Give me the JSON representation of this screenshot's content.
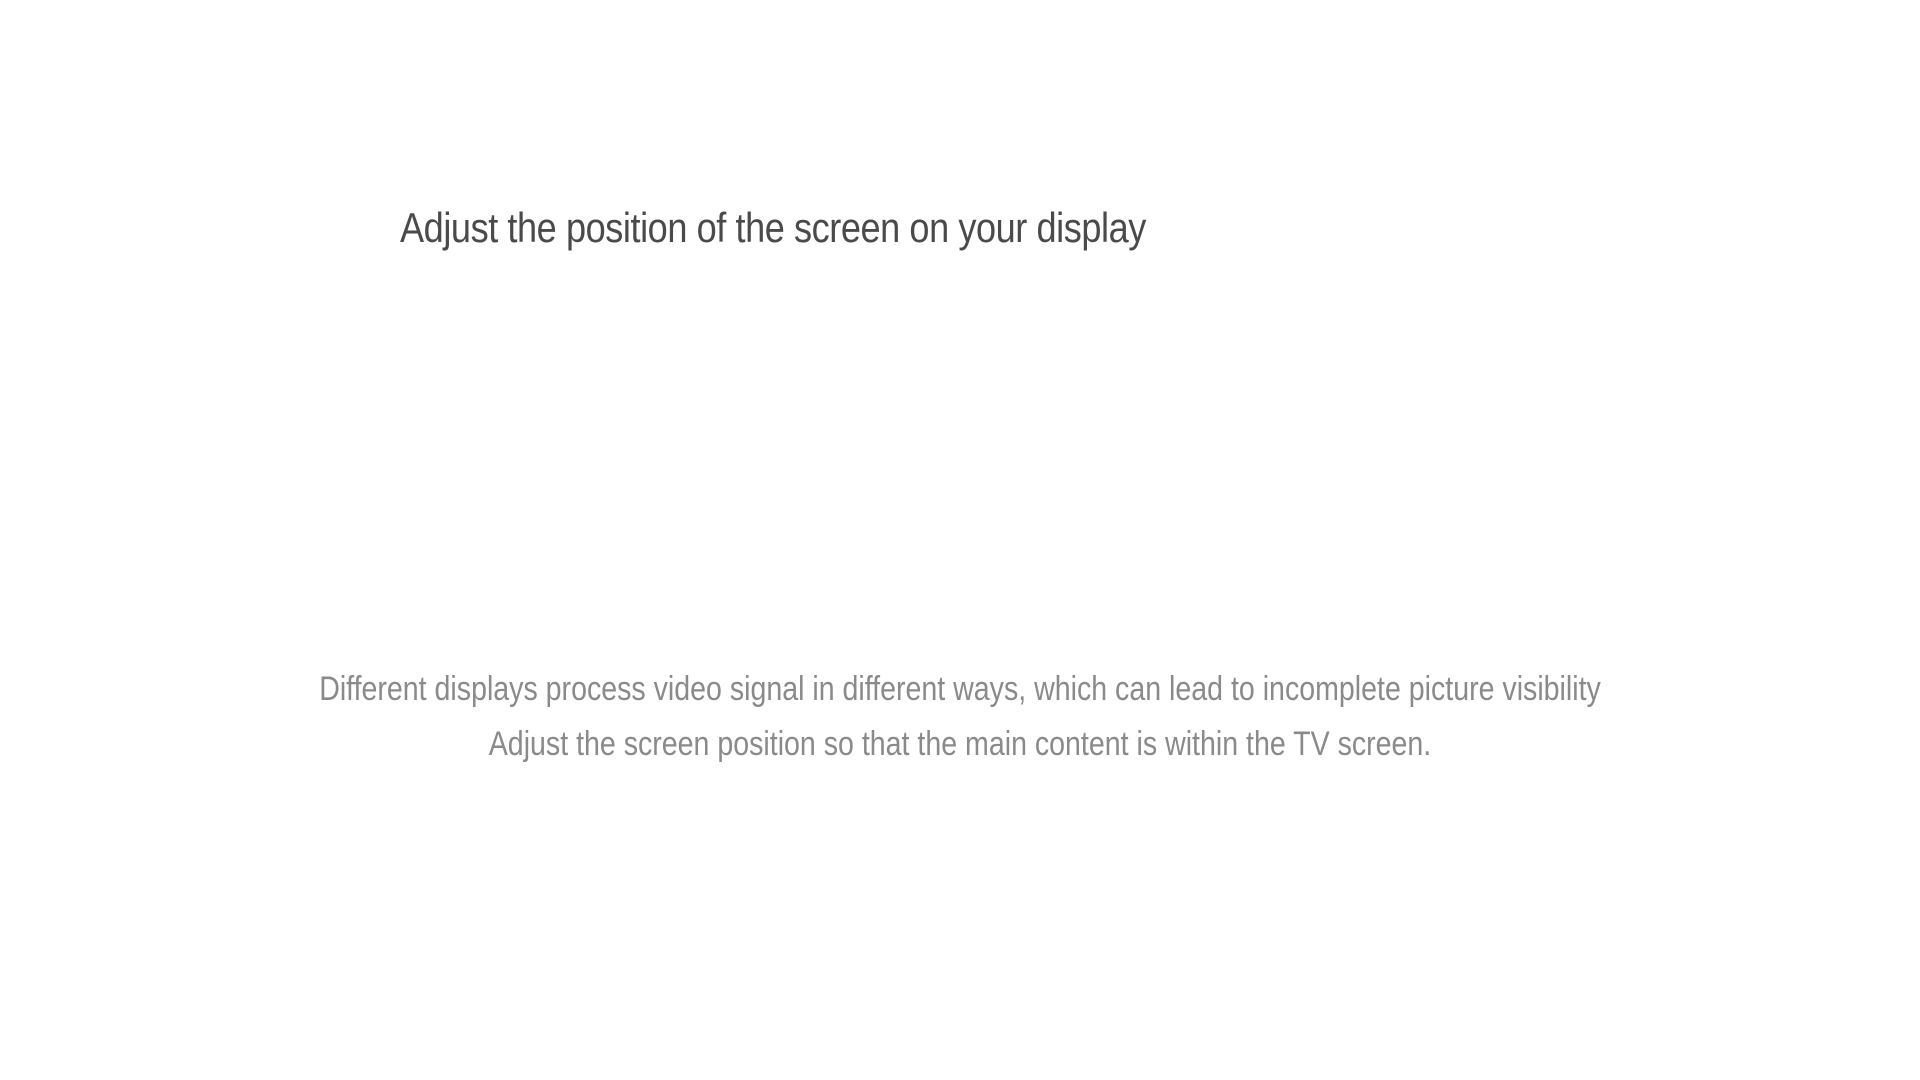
{
  "page": {
    "title": "Adjust the position of the screen on your display",
    "description": {
      "line1": "Different displays process video signal in different ways, which can lead to incomplete picture visibility",
      "line2": "Adjust the screen position so that the main content is within the TV screen."
    }
  },
  "colors": {
    "background": "#ffffff",
    "title": "#4a4a4a",
    "description": "#8a8a8a"
  }
}
